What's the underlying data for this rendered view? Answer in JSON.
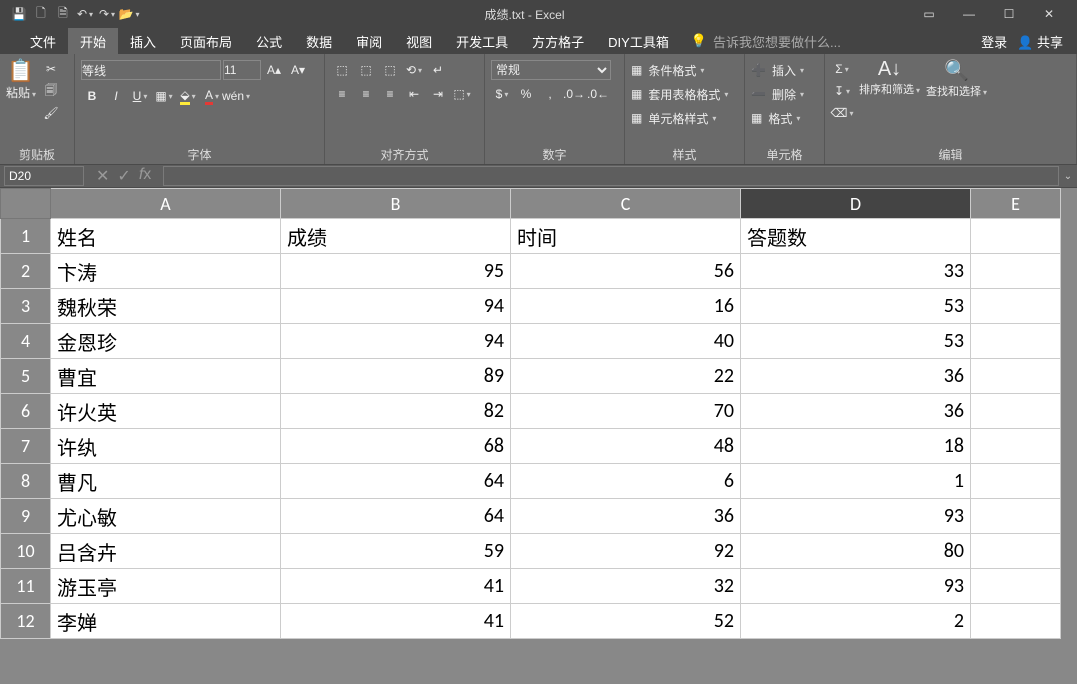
{
  "window": {
    "title": "成绩.txt - Excel",
    "login": "登录",
    "share": "共享"
  },
  "tabs": {
    "file": "文件",
    "home": "开始",
    "insert": "插入",
    "layout": "页面布局",
    "formulas": "公式",
    "data": "数据",
    "review": "审阅",
    "view": "视图",
    "dev": "开发工具",
    "fang": "方方格子",
    "diy": "DIY工具箱",
    "tellme": "告诉我您想要做什么..."
  },
  "ribbon": {
    "clipboard": {
      "paste": "粘贴",
      "label": "剪贴板"
    },
    "font": {
      "name": "等线",
      "size": "11",
      "label": "字体"
    },
    "align": {
      "label": "对齐方式"
    },
    "number": {
      "format": "常规",
      "label": "数字"
    },
    "styles": {
      "cond": "条件格式",
      "tbl": "套用表格格式",
      "cell": "单元格样式",
      "label": "样式"
    },
    "cells": {
      "insert": "插入",
      "delete": "删除",
      "format": "格式",
      "label": "单元格"
    },
    "editing": {
      "sort": "排序和筛选",
      "find": "查找和选择",
      "label": "编辑"
    }
  },
  "namebox": "D20",
  "chart_data": {
    "type": "table",
    "columns": [
      "A",
      "B",
      "C",
      "D",
      "E"
    ],
    "headers": [
      "姓名",
      "成绩",
      "时间",
      "答题数"
    ],
    "rows": [
      {
        "n": 1,
        "A": "姓名",
        "B": "成绩",
        "C": "时间",
        "D": "答题数"
      },
      {
        "n": 2,
        "A": "卞涛",
        "B": "95",
        "C": "56",
        "D": "33"
      },
      {
        "n": 3,
        "A": "魏秋荣",
        "B": "94",
        "C": "16",
        "D": "53"
      },
      {
        "n": 4,
        "A": "金恩珍",
        "B": "94",
        "C": "40",
        "D": "53"
      },
      {
        "n": 5,
        "A": "曹宜",
        "B": "89",
        "C": "22",
        "D": "36"
      },
      {
        "n": 6,
        "A": "许火英",
        "B": "82",
        "C": "70",
        "D": "36"
      },
      {
        "n": 7,
        "A": "许纨",
        "B": "68",
        "C": "48",
        "D": "18"
      },
      {
        "n": 8,
        "A": "曹凡",
        "B": "64",
        "C": "6",
        "D": "1"
      },
      {
        "n": 9,
        "A": "尤心敏",
        "B": "64",
        "C": "36",
        "D": "93"
      },
      {
        "n": 10,
        "A": "吕含卉",
        "B": "59",
        "C": "92",
        "D": "80"
      },
      {
        "n": 11,
        "A": "游玉亭",
        "B": "41",
        "C": "32",
        "D": "93"
      },
      {
        "n": 12,
        "A": "李婵",
        "B": "41",
        "C": "52",
        "D": "2"
      }
    ]
  },
  "colwidths": {
    "A": 230,
    "B": 230,
    "C": 230,
    "D": 230,
    "E": 90
  },
  "selected_col": "D"
}
